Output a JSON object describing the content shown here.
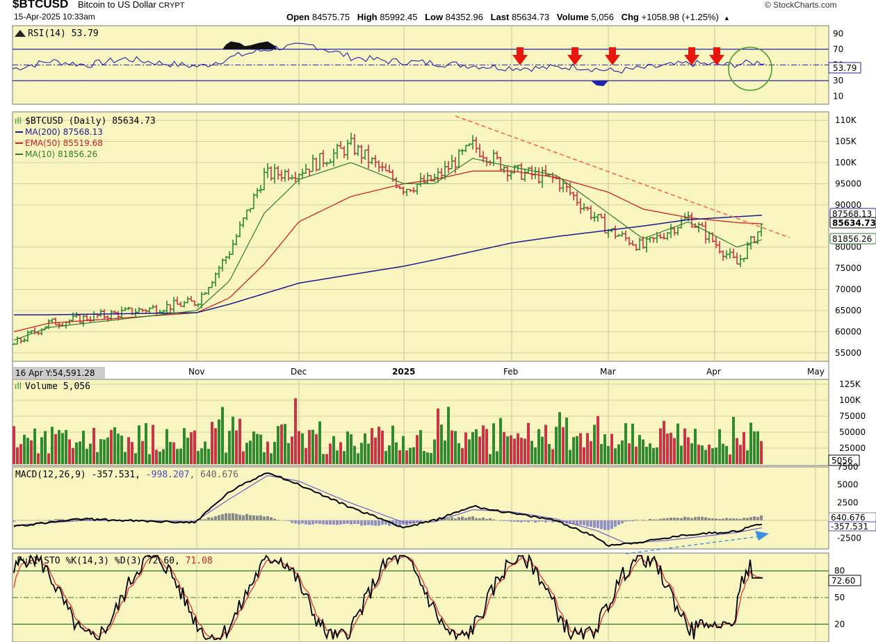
{
  "header": {
    "symbol": "$BTCUSD",
    "name": "Bitcoin to US Dollar",
    "exchange": "CRYPT",
    "datetime": "15-Apr-2025 10:33am",
    "brand": "© StockCharts.com",
    "open_label": "Open",
    "open": "84575.75",
    "high_label": "High",
    "high": "85992.45",
    "low_label": "Low",
    "low": "84352.96",
    "last_label": "Last",
    "last": "85634.73",
    "volume_label": "Volume",
    "volume": "5,056",
    "chg_label": "Chg",
    "chg": "+1058.98 (+1.25%)"
  },
  "colors": {
    "background": "#f8f5c0",
    "grid": "#c9c79a",
    "up": "#2e8b2e",
    "down": "#cc3344",
    "ma200": "#1a1a8c",
    "ema50": "#cc2222",
    "ma10": "#2e7d2e",
    "trend": "#ff5533",
    "arrow": "#e8170e",
    "circle": "#4a9a2a",
    "macd_signal": "#6a60c8",
    "bluearrow": "#3a8fe0"
  },
  "chart_data": [
    {
      "type": "line",
      "panel": "RSI",
      "title": "RSI(14) 53.79",
      "current": "53.79",
      "levels": [
        70,
        30,
        50
      ],
      "ylim": [
        0,
        100
      ],
      "yticks": [
        "90",
        "70",
        "50",
        "30",
        "10"
      ],
      "series": [
        {
          "name": "RSI(14)",
          "x": [
            0,
            0.05,
            0.1,
            0.15,
            0.2,
            0.25,
            0.3,
            0.35,
            0.4,
            0.45,
            0.5,
            0.55,
            0.6,
            0.65,
            0.7,
            0.75,
            0.8,
            0.85,
            0.9,
            0.95,
            1.0
          ],
          "values": [
            45,
            55,
            50,
            58,
            52,
            48,
            62,
            72,
            75,
            60,
            55,
            53,
            50,
            47,
            46,
            48,
            42,
            47,
            52,
            50,
            54
          ]
        }
      ],
      "annotations": [
        "down-arrows x5",
        "circle near end"
      ]
    },
    {
      "type": "line",
      "panel": "Price",
      "title": "$BTCUSD (Daily) 85634.73",
      "legend": [
        "MA(200) 87568.13",
        "EMA(50) 85519.68",
        "MA(10) 81856.26"
      ],
      "xticks": [
        "16 Apr Y:54,591.28",
        "Nov",
        "Dec",
        "2025",
        "Feb",
        "Mar",
        "Apr",
        "May"
      ],
      "yticks": [
        "110K",
        "105K",
        "100K",
        "95000",
        "90000",
        "80000",
        "75000",
        "70000",
        "65000",
        "60000",
        "55000"
      ],
      "ylim": [
        53000,
        112000
      ],
      "last_labels": [
        "87568.13",
        "85634.73",
        "81856.26"
      ],
      "series": [
        {
          "name": "$BTCUSD (Daily)",
          "dates": [
            "Oct 1",
            "Oct 15",
            "Nov 1",
            "Nov 12",
            "Nov 22",
            "Dec 5",
            "Dec 17",
            "Jan 1",
            "Jan 10",
            "Jan 20",
            "Feb 1",
            "Feb 15",
            "Mar 1",
            "Mar 10",
            "Mar 25",
            "Apr 8",
            "Apr 15"
          ],
          "values": [
            57000,
            62000,
            67000,
            79000,
            97000,
            98000,
            104000,
            94000,
            96000,
            104000,
            98000,
            96000,
            84000,
            80000,
            87000,
            76000,
            85634
          ]
        },
        {
          "name": "MA(200)",
          "values": [
            64000,
            64000,
            64500,
            66500,
            69000,
            71500,
            73500,
            75500,
            77000,
            79000,
            81000,
            82500,
            84000,
            85000,
            86500,
            87200,
            87568
          ]
        },
        {
          "name": "EMA(50)",
          "values": [
            60000,
            62000,
            64500,
            68000,
            76000,
            86000,
            92000,
            95000,
            96000,
            98000,
            98000,
            96500,
            93000,
            89000,
            87000,
            85800,
            85519
          ]
        },
        {
          "name": "MA(10)",
          "values": [
            58000,
            61000,
            65000,
            72000,
            88000,
            96000,
            100000,
            95000,
            95000,
            101000,
            99000,
            97000,
            88000,
            82000,
            86000,
            80000,
            81856
          ]
        }
      ]
    },
    {
      "type": "bar",
      "panel": "Volume",
      "title": "Volume 5,056",
      "current": "5056",
      "yticks": [
        "125K",
        "100K",
        "75000",
        "50000",
        "25000"
      ],
      "ylim": [
        0,
        125000
      ]
    },
    {
      "type": "line",
      "panel": "MACD",
      "title_parts": [
        "MACD(12,26,9) -357.531, ",
        "-998.207",
        ", 640.676"
      ],
      "yticks": [
        "7500",
        "5000",
        "2500",
        "-2500"
      ],
      "last_labels": [
        "640.676",
        "-357.531"
      ],
      "ylim": [
        -4000,
        7500
      ]
    },
    {
      "type": "line",
      "panel": "Full STO",
      "title_parts": [
        "Full STO %K(14,3) %D(3) 72.60, ",
        "71.08"
      ],
      "yticks": [
        "80",
        "50",
        "20"
      ],
      "current": "72.60",
      "ylim": [
        0,
        100
      ]
    }
  ]
}
